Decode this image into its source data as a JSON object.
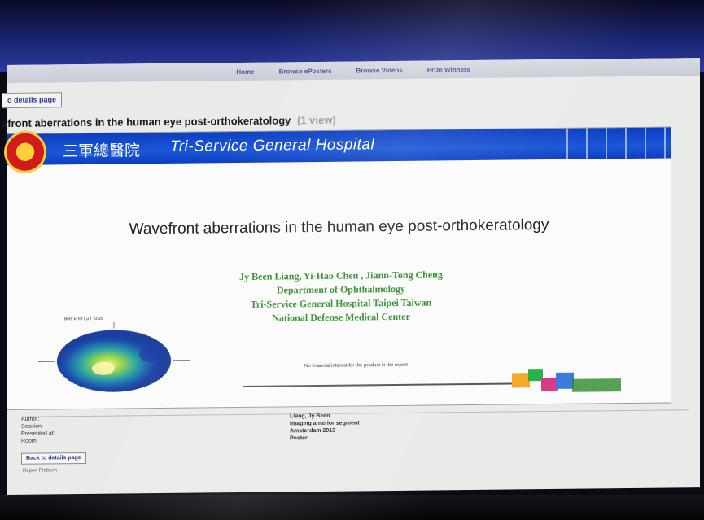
{
  "nav": {
    "items": [
      "Home",
      "Browse ePosters",
      "Browse Videos",
      "Prize Winners"
    ]
  },
  "back_top_label": "o details page",
  "page_heading": {
    "title": "efront aberrations in the human eye post-orthokeratology",
    "views": "(1 view)"
  },
  "poster": {
    "header_cn": "三軍總醫院",
    "header_en": "Tri-Service General Hospital",
    "title": "Wavefront aberrations in the human eye post-orthokeratology",
    "authors": [
      "Jy Been Liang, Yi-Hao Chen ,  Jiann-Tong Cheng",
      "Department of Ophthalmology",
      "Tri-Service  General Hospital Taipei Taiwan",
      "National Defense Medical Center"
    ],
    "map_label": "Beta Error ( μ ) : 0.16",
    "disclaimer": "No financial interest for the product in the report"
  },
  "meta": {
    "rows": [
      {
        "key": "Author:",
        "value": "Liang, Jy Been"
      },
      {
        "key": "Session:",
        "value": "Imaging anterior segment"
      },
      {
        "key": "Presented at:",
        "value": "Amsterdam 2013"
      },
      {
        "key": "Room:",
        "value": "Poster"
      }
    ]
  },
  "back_bottom_label": "Back to details page",
  "report_label": "Report Problem",
  "colors": {
    "header_blue": "#1b57d6",
    "author_green": "#2f8a2a",
    "nav_link": "#4a55a0"
  }
}
